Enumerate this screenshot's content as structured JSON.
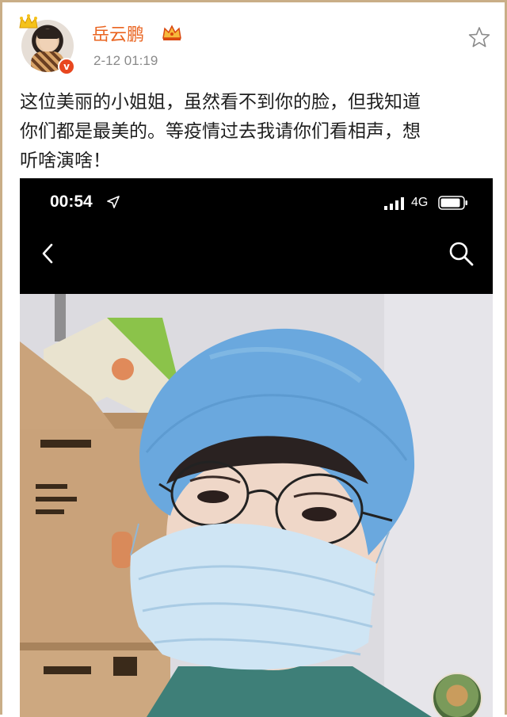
{
  "post": {
    "username": "岳云鹏",
    "timestamp": "2-12 01:19",
    "text_lines": [
      "这位美丽的小姐姐，虽然看不到你的脸，但我知道",
      "你们都是最美的。等疫情过去我请你们看相声，想",
      "听啥演啥！"
    ]
  },
  "embedded_screenshot": {
    "status_bar": {
      "time": "00:54",
      "network": "4G"
    }
  },
  "colors": {
    "frame": "#c9ae87",
    "username": "#ea6420",
    "timestamp": "#8a8a8a",
    "verified_badge": "#e8471f",
    "cap": "#6aa8de",
    "mask": "#cfe5f4"
  },
  "icons": [
    "crown-icon",
    "vip-crown-icon",
    "verified-icon",
    "star-icon",
    "location-arrow-icon",
    "signal-icon",
    "battery-icon",
    "back-icon",
    "search-icon"
  ]
}
